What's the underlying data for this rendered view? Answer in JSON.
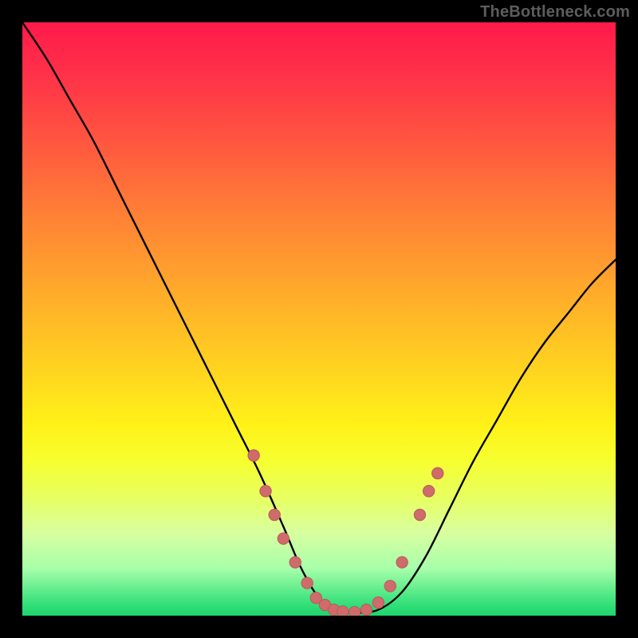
{
  "attribution": "TheBottleneck.com",
  "colors": {
    "curve_stroke": "#000000",
    "marker_fill": "#cf6b6b",
    "marker_stroke": "#b65b5b"
  },
  "chart_data": {
    "type": "line",
    "title": "",
    "xlabel": "",
    "ylabel": "",
    "xlim": [
      0,
      100
    ],
    "ylim": [
      0,
      100
    ],
    "series": [
      {
        "name": "curve",
        "x": [
          0,
          4,
          8,
          12,
          16,
          20,
          24,
          28,
          32,
          36,
          40,
          44,
          47,
          50,
          53,
          56,
          60,
          64,
          68,
          72,
          76,
          80,
          84,
          88,
          92,
          96,
          100
        ],
        "y": [
          100,
          94,
          87,
          80,
          72,
          64,
          56,
          48,
          40,
          32,
          24,
          15,
          8,
          3,
          1,
          0.5,
          1,
          4,
          10,
          18,
          26,
          33,
          40,
          46,
          51,
          56,
          60
        ]
      }
    ],
    "markers": [
      {
        "x": 39,
        "y": 27
      },
      {
        "x": 41,
        "y": 21
      },
      {
        "x": 42.5,
        "y": 17
      },
      {
        "x": 44,
        "y": 13
      },
      {
        "x": 46,
        "y": 9
      },
      {
        "x": 48,
        "y": 5.5
      },
      {
        "x": 49.5,
        "y": 3
      },
      {
        "x": 51,
        "y": 1.8
      },
      {
        "x": 52.5,
        "y": 1
      },
      {
        "x": 54,
        "y": 0.7
      },
      {
        "x": 56,
        "y": 0.6
      },
      {
        "x": 58,
        "y": 1
      },
      {
        "x": 60,
        "y": 2.2
      },
      {
        "x": 62,
        "y": 5
      },
      {
        "x": 64,
        "y": 9
      },
      {
        "x": 67,
        "y": 17
      },
      {
        "x": 68.5,
        "y": 21
      },
      {
        "x": 70,
        "y": 24
      }
    ]
  }
}
